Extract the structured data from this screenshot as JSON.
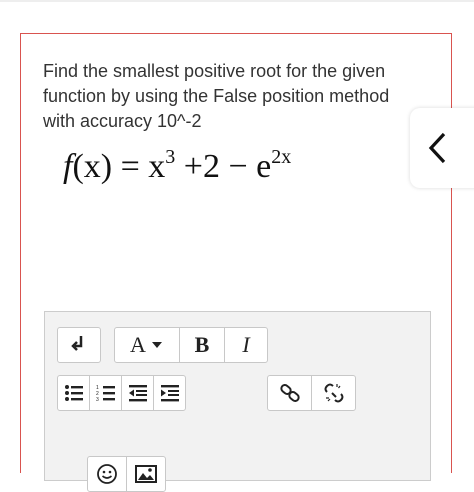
{
  "question": {
    "text": "Find the smallest positive root for the given function by using the False position method with accuracy 10^-2"
  },
  "formula": {
    "lhs": "f",
    "arg": "(x)",
    "eq": " = x",
    "exp1": "3",
    "mid": " +2 − e",
    "exp2": "2x"
  },
  "toolbar": {
    "font_label": "A",
    "bold_label": "B",
    "italic_label": "I"
  },
  "icons": {
    "collapse": "expand-arrow-icon",
    "bullet_list": "bullet-list-icon",
    "numbered_list": "numbered-list-icon",
    "outdent": "outdent-icon",
    "indent": "indent-icon",
    "link": "link-icon",
    "unlink": "unlink-icon",
    "emoji": "emoji-icon",
    "image": "image-icon",
    "back": "chevron-left-icon"
  },
  "colors": {
    "card_border": "#d9534f",
    "toolbar_bg": "#f2f2f2"
  }
}
